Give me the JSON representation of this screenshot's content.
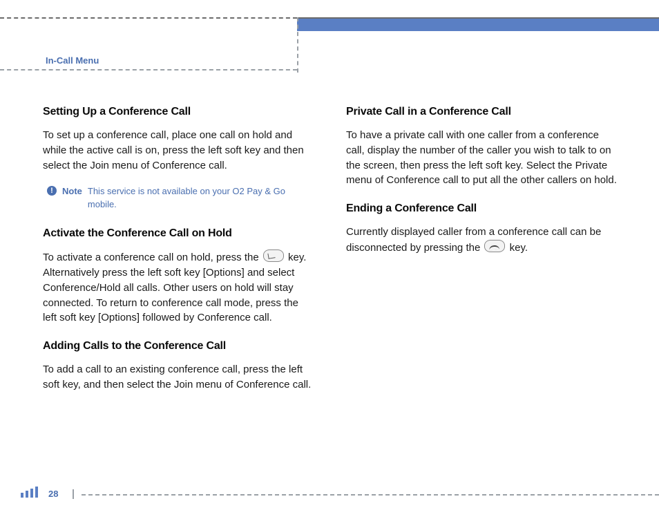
{
  "header": {
    "section": "In-Call Menu"
  },
  "left": {
    "h1": "Setting Up a Conference Call",
    "p1": "To set up a conference call, place one call on hold and while the active call is on, press the left soft key and then select the Join menu of Conference call.",
    "note_label": "Note",
    "note_text": "This service is not available on your O2 Pay & Go mobile.",
    "h2": "Activate the Conference Call on Hold",
    "p2a": "To activate a conference call on hold, press the ",
    "p2b": " key. Alternatively press the left soft key [Options] and select Conference/Hold all calls. Other users on hold will stay connected. To return to conference call mode, press the left soft key [Options] followed by Conference call.",
    "h3": "Adding Calls to the Conference Call",
    "p3": "To add a call to an existing conference call, press the left soft key, and then select the Join menu of Conference call."
  },
  "right": {
    "h1": "Private Call in a Conference Call",
    "p1": "To have a private call with one caller from a conference call, display the number of the caller you wish to talk to on the screen, then press the left soft key. Select the Private menu of Conference call to put all the other callers on hold.",
    "h2": "Ending a Conference Call",
    "p2a": "Currently displayed caller from a conference call can be disconnected by pressing the ",
    "p2b": " key."
  },
  "footer": {
    "page_number": "28"
  }
}
